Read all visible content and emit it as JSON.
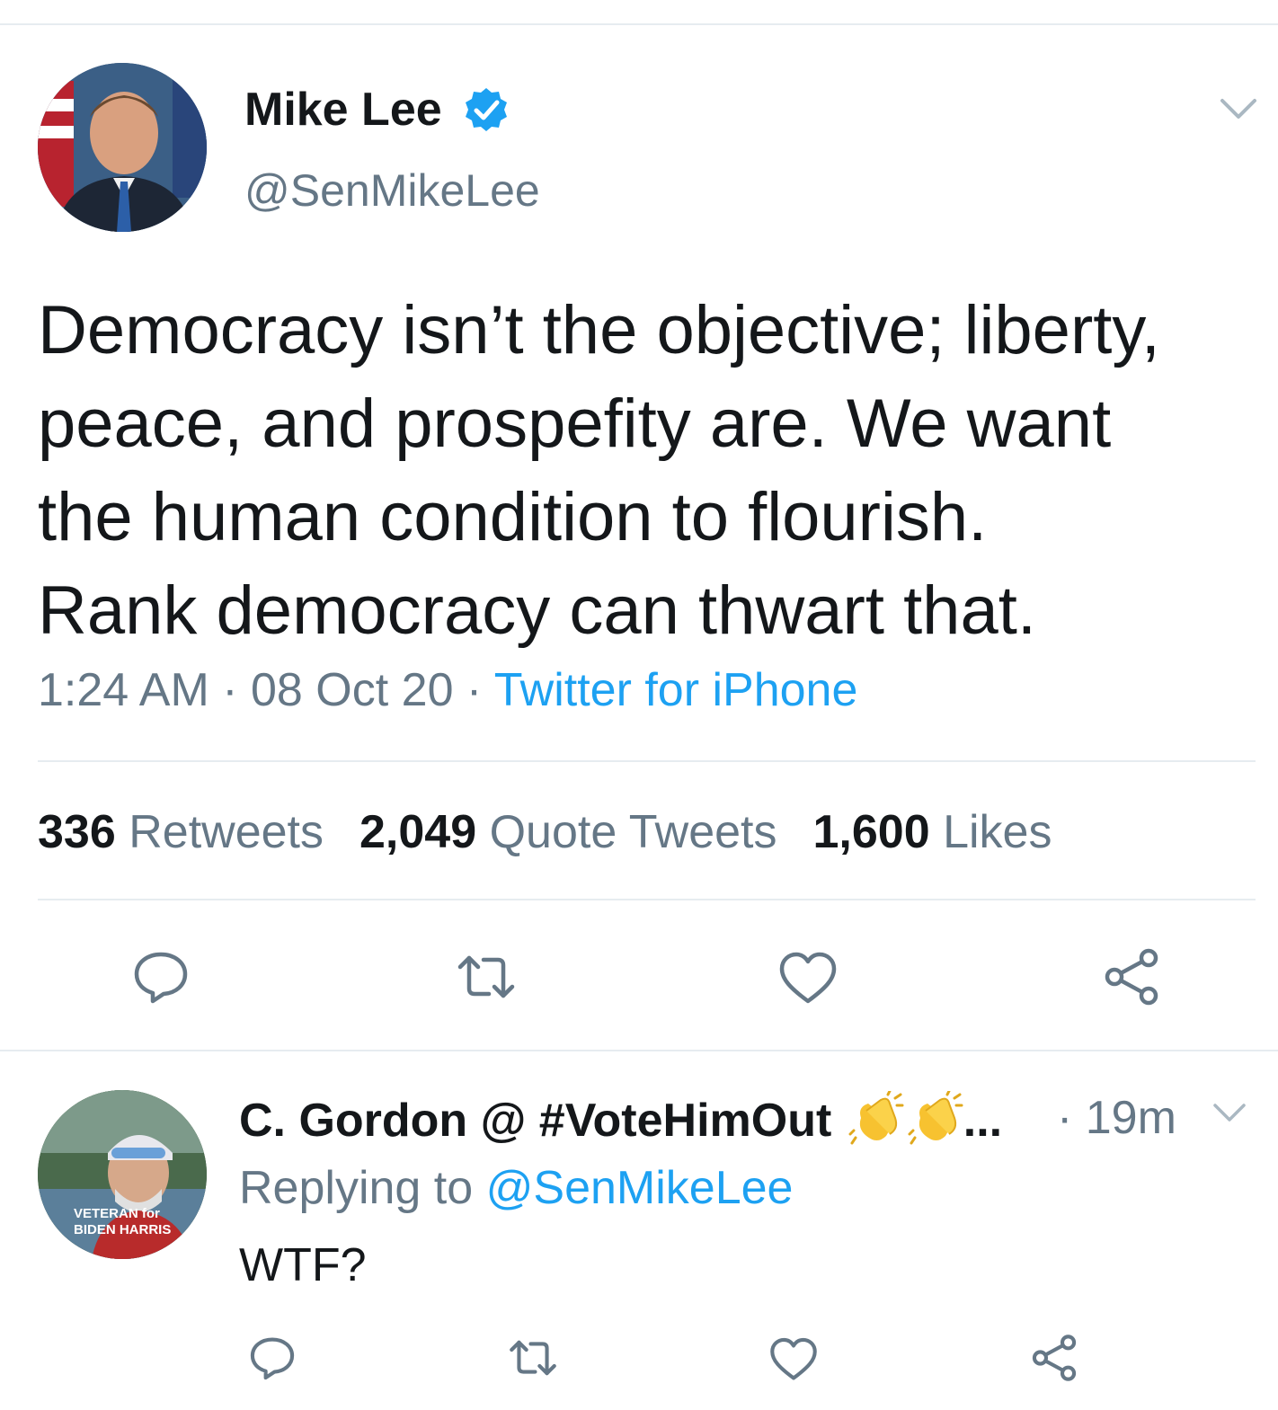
{
  "tweet": {
    "author": {
      "name": "Mike Lee",
      "handle": "@SenMikeLee",
      "verified": true
    },
    "text": "Democracy isn’t the objective; liberty,\npeace, and prospefity are.  We want\nthe human condition to flourish.\nRank democracy can thwart that.",
    "time": "1:24 AM",
    "sep1": " · ",
    "date": "08 Oct 20",
    "sep2": " · ",
    "source": "Twitter for iPhone",
    "stats": {
      "retweets_count": "336",
      "retweets_label": "Retweets",
      "quotes_count": "2,049",
      "quotes_label": "Quote Tweets",
      "likes_count": "1,600",
      "likes_label": "Likes"
    },
    "actions": [
      "reply-icon",
      "retweet-icon",
      "like-icon",
      "share-icon"
    ]
  },
  "reply": {
    "author": {
      "name": "C. Gordon @ #VoteHimOut",
      "truncation": "..."
    },
    "avatar_overlay": [
      "VETERAN for",
      "BIDEN HARRIS"
    ],
    "time": "· 19m",
    "replying_prefix": "Replying to ",
    "replying_to": "@SenMikeLee",
    "text": "WTF?",
    "actions": [
      "reply-icon",
      "retweet-icon",
      "like-icon",
      "share-icon"
    ]
  },
  "colors": {
    "accent": "#1da1f2",
    "secondary_text": "#657786",
    "primary_text": "#14171a",
    "divider": "#e6ecf0"
  }
}
